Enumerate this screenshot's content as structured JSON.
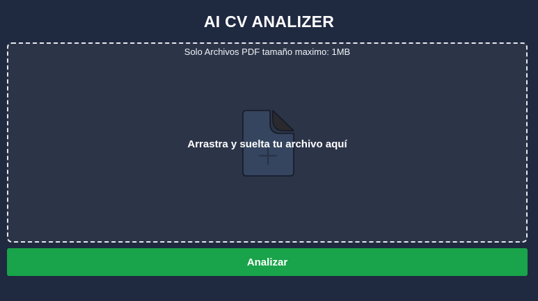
{
  "header": {
    "title": "AI CV ANALIZER"
  },
  "dropzone": {
    "hint": "Solo Archivos PDF tamaño maximo: 1MB",
    "instruction": "Arrastra y suelta tu archivo aquí",
    "icon": "file-add-icon"
  },
  "actions": {
    "analyze_label": "Analizar"
  },
  "colors": {
    "background": "#1f2940",
    "dropzone_background": "#2c3448",
    "accent": "#19a34a",
    "text": "#ffffff"
  }
}
